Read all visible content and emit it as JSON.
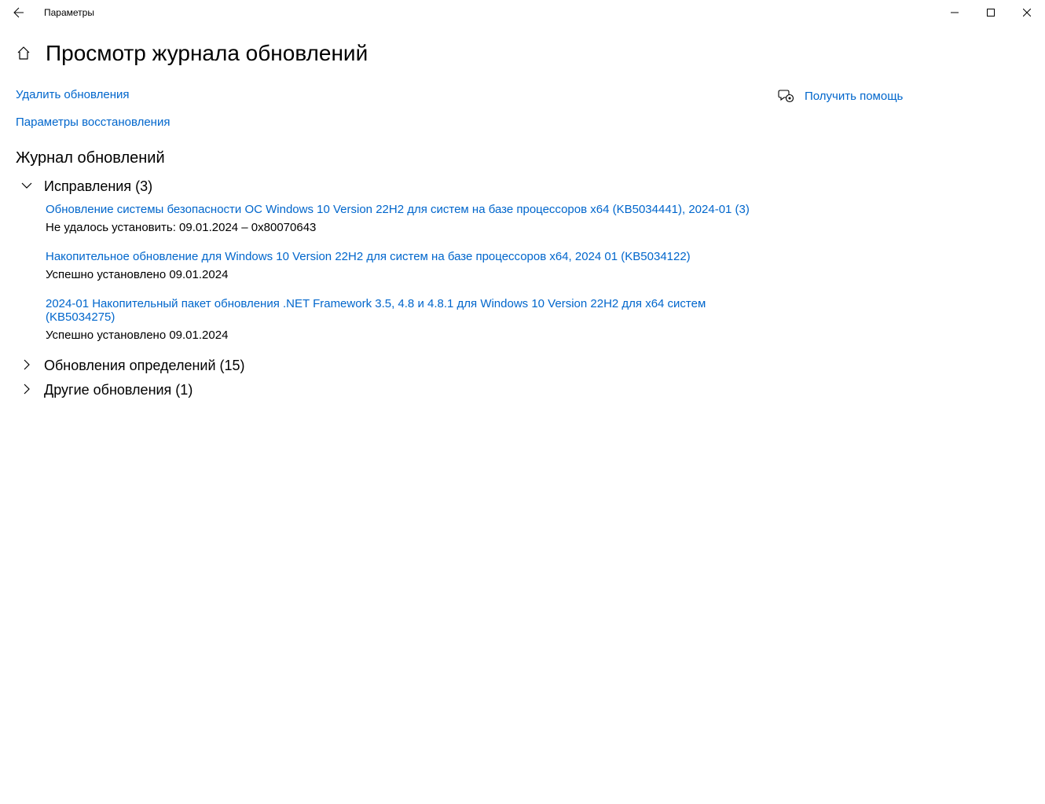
{
  "titlebar": {
    "app_name": "Параметры"
  },
  "page": {
    "title": "Просмотр журнала обновлений"
  },
  "links": {
    "uninstall": "Удалить обновления",
    "recovery": "Параметры восстановления"
  },
  "help": {
    "label": "Получить помощь"
  },
  "history": {
    "section_title": "Журнал обновлений",
    "groups": [
      {
        "label": "Исправления (3)",
        "expanded": true,
        "items": [
          {
            "title": "Обновление системы безопасности ОС Windows 10 Version 22H2 для систем на базе процессоров x64 (KB5034441), 2024-01 (3)",
            "status": "Не удалось установить: 09.01.2024 – 0x80070643"
          },
          {
            "title": "Накопительное обновление для Windows 10 Version 22H2 для систем на базе процессоров x64, 2024 01 (KB5034122)",
            "status": "Успешно установлено 09.01.2024"
          },
          {
            "title": "2024-01 Накопительный пакет обновления .NET Framework 3.5, 4.8 и 4.8.1 для Windows 10 Version 22H2 для x64 систем (KB5034275)",
            "status": "Успешно установлено 09.01.2024"
          }
        ]
      },
      {
        "label": "Обновления определений (15)",
        "expanded": false,
        "items": []
      },
      {
        "label": "Другие обновления (1)",
        "expanded": false,
        "items": []
      }
    ]
  }
}
